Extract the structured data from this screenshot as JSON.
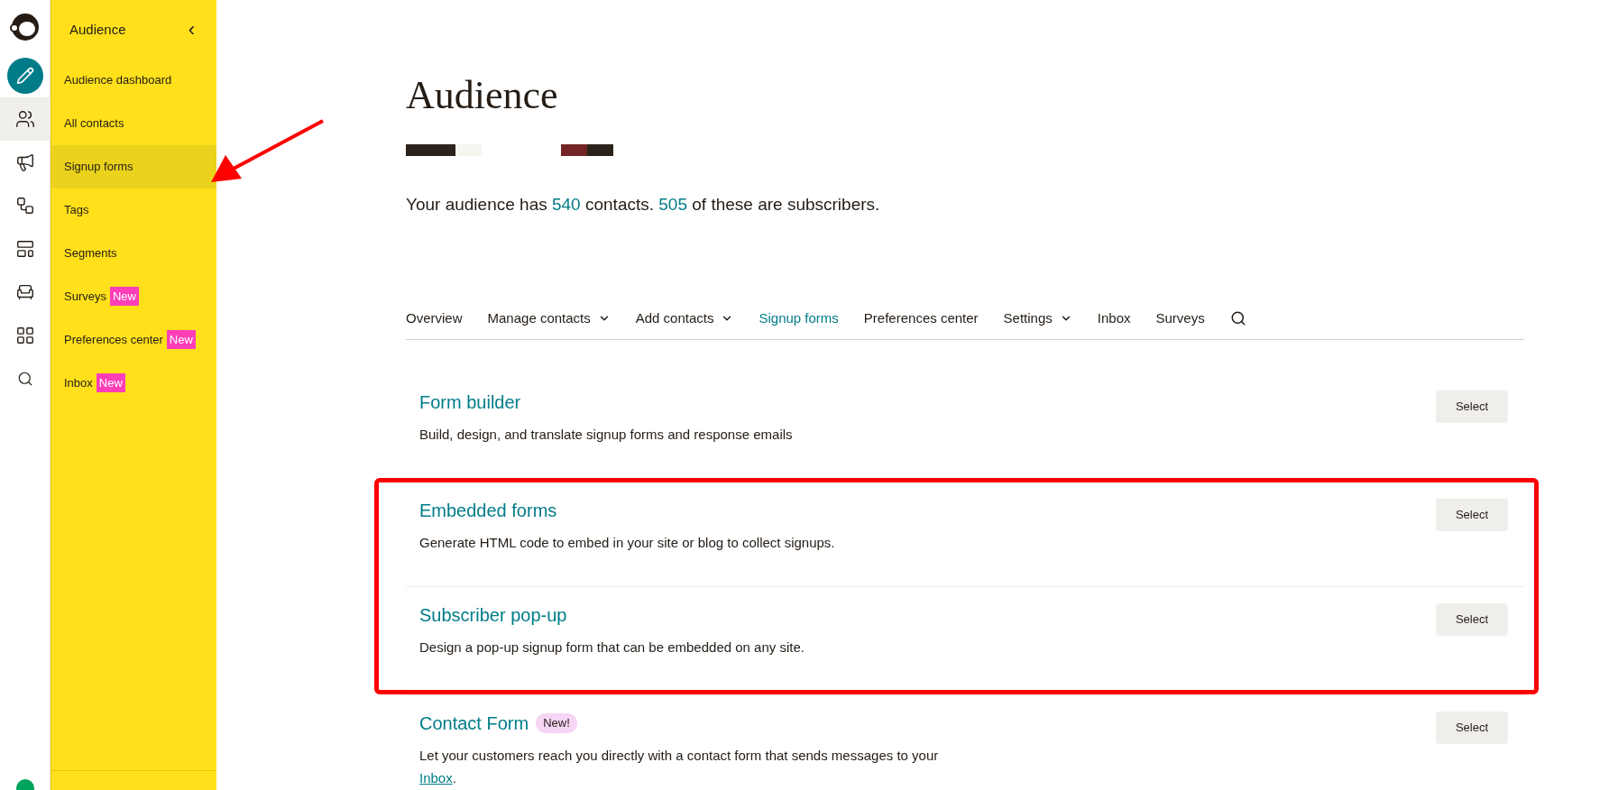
{
  "rail": [
    {
      "kind": "create",
      "selected": false
    },
    {
      "kind": "audience",
      "selected": true
    },
    {
      "kind": "campaigns",
      "selected": false
    },
    {
      "kind": "automations",
      "selected": false
    },
    {
      "kind": "website",
      "selected": false
    },
    {
      "kind": "content",
      "selected": false
    },
    {
      "kind": "integrations",
      "selected": false
    },
    {
      "kind": "search",
      "selected": false
    }
  ],
  "sidebar": {
    "title": "Audience",
    "collapse": "‹",
    "items": [
      {
        "label": "Audience dashboard",
        "selected": false
      },
      {
        "label": "All contacts",
        "selected": false
      },
      {
        "label": "Signup forms",
        "selected": true
      },
      {
        "label": "Tags",
        "selected": false
      },
      {
        "label": "Segments",
        "selected": false
      },
      {
        "label": "Surveys",
        "selected": false,
        "badge": "New"
      },
      {
        "label": "Preferences center",
        "selected": false,
        "badge": "New"
      },
      {
        "label": "Inbox",
        "selected": false,
        "badge": "New"
      }
    ]
  },
  "page": {
    "title": "Audience",
    "summary": [
      {
        "text": "Your audience has ",
        "highlight": false
      },
      {
        "text": "540",
        "highlight": true
      },
      {
        "text": " contacts. ",
        "highlight": false
      },
      {
        "text": "505",
        "highlight": true
      },
      {
        "text": " of these are subscribers.",
        "highlight": false
      }
    ]
  },
  "tabs": [
    {
      "label": "Overview",
      "selected": false,
      "dropdown": false
    },
    {
      "label": "Manage contacts",
      "selected": false,
      "dropdown": true
    },
    {
      "label": "Add contacts",
      "selected": false,
      "dropdown": true
    },
    {
      "label": "Signup forms",
      "selected": true,
      "dropdown": false
    },
    {
      "label": "Preferences center",
      "selected": false,
      "dropdown": false
    },
    {
      "label": "Settings",
      "selected": false,
      "dropdown": true
    },
    {
      "label": "Inbox",
      "selected": false,
      "dropdown": false
    },
    {
      "label": "Surveys",
      "selected": false,
      "dropdown": false
    }
  ],
  "options": [
    {
      "title": "Form builder",
      "description": [
        {
          "text": "Build, design, and translate signup forms and response emails",
          "link": false
        }
      ],
      "button": "Select",
      "highlighted": false
    },
    {
      "title": "Embedded forms",
      "description": [
        {
          "text": "Generate HTML code to embed in your site or blog to collect signups.",
          "link": false
        }
      ],
      "button": "Select",
      "highlighted": true
    },
    {
      "title": "Subscriber pop-up",
      "description": [
        {
          "text": "Design a pop-up signup form that can be embedded on any site.",
          "link": false
        }
      ],
      "button": "Select",
      "highlighted": true
    },
    {
      "title": "Contact Form",
      "badge": "New!",
      "description": [
        {
          "text": "Let your customers reach you directly with a contact form that sends messages to your ",
          "link": false
        },
        {
          "text": "Inbox",
          "link": true
        },
        {
          "text": ".",
          "link": false
        }
      ],
      "button": "Select",
      "highlighted": false
    }
  ]
}
